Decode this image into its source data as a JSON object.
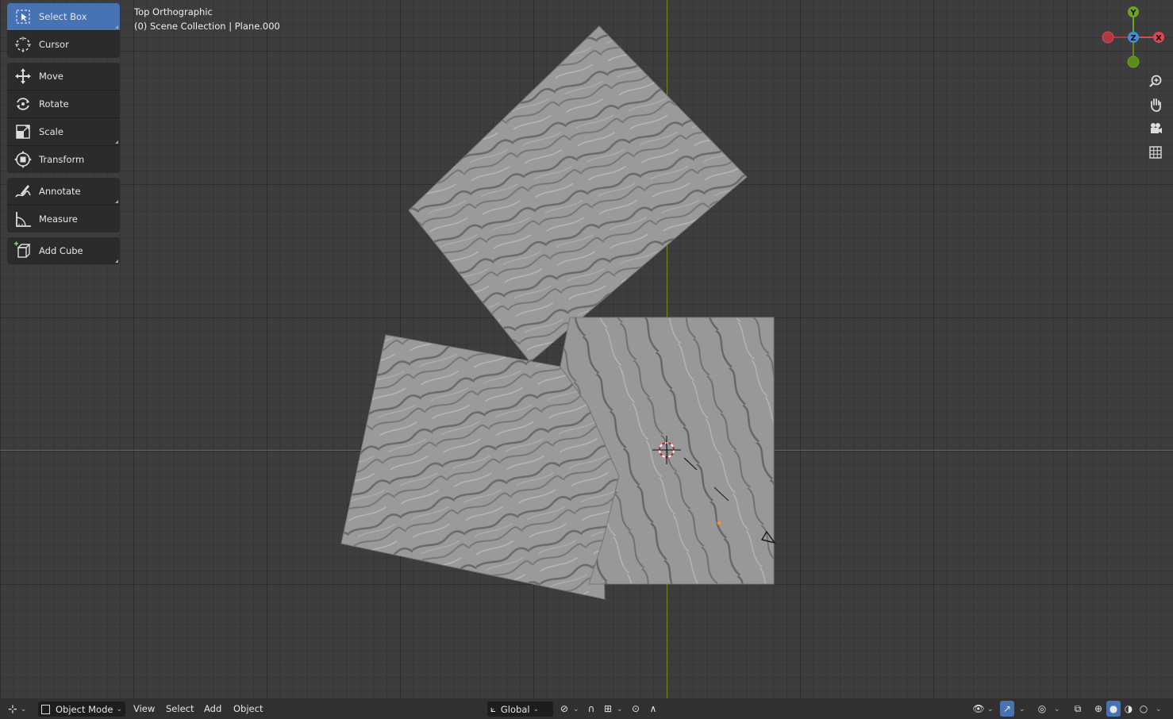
{
  "viewport": {
    "view_name": "Top Orthographic",
    "collection_line": "(0) Scene Collection | Plane.000"
  },
  "toolbar": {
    "tools": [
      {
        "label": "Select Box",
        "icon": "select-box-icon",
        "active": true
      },
      {
        "label": "Cursor",
        "icon": "cursor-icon"
      },
      {
        "label": "Move",
        "icon": "move-icon"
      },
      {
        "label": "Rotate",
        "icon": "rotate-icon"
      },
      {
        "label": "Scale",
        "icon": "scale-icon"
      },
      {
        "label": "Transform",
        "icon": "transform-icon"
      },
      {
        "label": "Annotate",
        "icon": "annotate-icon"
      },
      {
        "label": "Measure",
        "icon": "measure-icon"
      },
      {
        "label": "Add Cube",
        "icon": "add-cube-icon"
      }
    ]
  },
  "gizmo": {
    "x_label": "X",
    "y_label": "Y",
    "z_label": "Z"
  },
  "header": {
    "mode_label": "Object Mode",
    "menus": [
      "View",
      "Select",
      "Add",
      "Object"
    ],
    "orientation_label": "Global"
  },
  "colors": {
    "accent": "#4772b3",
    "axis_x": "#e0464f",
    "axis_y": "#6ba51d",
    "axis_z": "#3d8fe0"
  }
}
